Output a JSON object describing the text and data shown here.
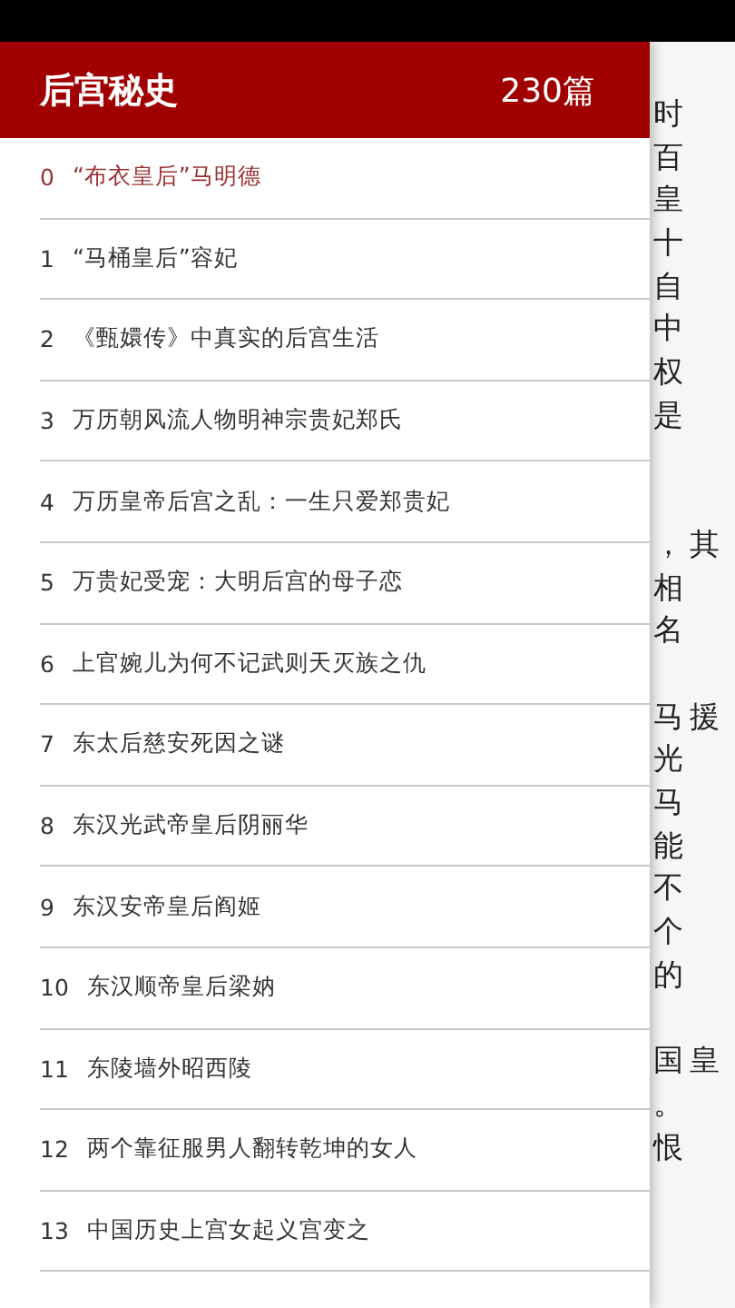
{
  "drawer": {
    "title": "后宫秘史",
    "count": "230篇",
    "items": [
      {
        "number": "0",
        "title": "“布衣皇后”马明德",
        "selected": true
      },
      {
        "number": "1",
        "title": "“马桶皇后”容妃",
        "selected": false
      },
      {
        "number": "2",
        "title": "《甄嬛传》中真实的后宫生活",
        "selected": false
      },
      {
        "number": "3",
        "title": "万历朝风流人物明神宗贵妃郑氏",
        "selected": false
      },
      {
        "number": "4",
        "title": "万历皇帝后宫之乱：一生只爱郑贵妃",
        "selected": false
      },
      {
        "number": "5",
        "title": "万贵妃受宠：大明后宫的母子恋",
        "selected": false
      },
      {
        "number": "6",
        "title": "上官婉儿为何不记武则天灭族之仇",
        "selected": false
      },
      {
        "number": "7",
        "title": "东太后慈安死因之谜",
        "selected": false
      },
      {
        "number": "8",
        "title": "东汉光武帝皇后阴丽华",
        "selected": false
      },
      {
        "number": "9",
        "title": "东汉安帝皇后阎姬",
        "selected": false
      },
      {
        "number": "10",
        "title": "东汉顺帝皇后梁妠",
        "selected": false
      },
      {
        "number": "11",
        "title": "东陵墙外昭西陵",
        "selected": false
      },
      {
        "number": "12",
        "title": "两个靠征服男人翻转乾坤的女人",
        "selected": false
      },
      {
        "number": "13",
        "title": "中国历史上宫女起义宫变之",
        "selected": false
      }
    ]
  },
  "page_text": [
    {
      "kind": "line",
      "text": "时"
    },
    {
      "kind": "line",
      "text": "百"
    },
    {
      "kind": "line",
      "text": "皇"
    },
    {
      "kind": "line",
      "text": "十"
    },
    {
      "kind": "line",
      "text": "自"
    },
    {
      "kind": "line",
      "text": "中"
    },
    {
      "kind": "line",
      "text": "权"
    },
    {
      "kind": "line",
      "text": "是"
    },
    {
      "kind": "blank"
    },
    {
      "kind": "blank"
    },
    {
      "kind": "line",
      "text": "，其"
    },
    {
      "kind": "line",
      "text": "相"
    },
    {
      "kind": "line",
      "text": "名"
    },
    {
      "kind": "blank"
    },
    {
      "kind": "line",
      "text": "马援"
    },
    {
      "kind": "line",
      "text": "光"
    },
    {
      "kind": "line",
      "text": "马"
    },
    {
      "kind": "line",
      "text": "能"
    },
    {
      "kind": "line",
      "text": "不"
    },
    {
      "kind": "line",
      "text": "个"
    },
    {
      "kind": "line",
      "text": "的"
    },
    {
      "kind": "blank"
    },
    {
      "kind": "line",
      "text": "国皇"
    },
    {
      "kind": "line",
      "text": "。"
    },
    {
      "kind": "line",
      "text": "恨"
    }
  ]
}
